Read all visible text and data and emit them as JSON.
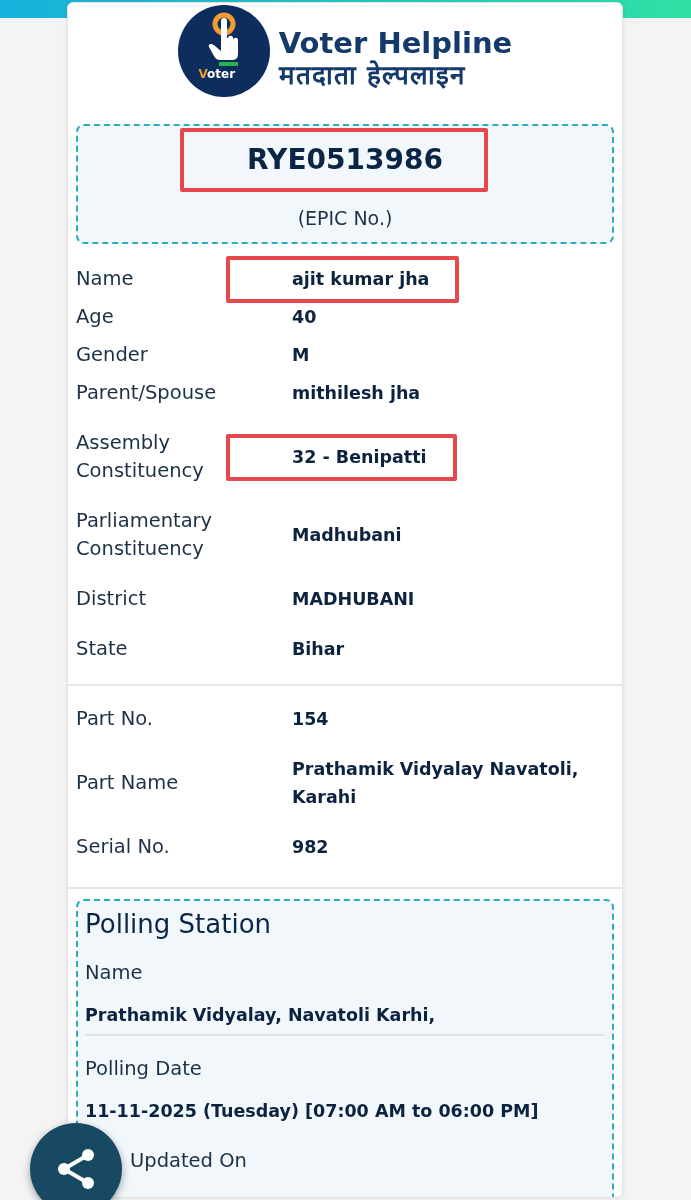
{
  "header": {
    "logo_caption": "Voter",
    "title": "Voter Helpline",
    "subtitle": "मतदाता हेल्पलाइन"
  },
  "epic": {
    "number": "RYE0513986",
    "caption": "(EPIC No.)",
    "highlighted": true
  },
  "voter_details": [
    {
      "label": "Name",
      "value": "ajit kumar jha",
      "highlighted": true
    },
    {
      "label": "Age",
      "value": "40",
      "highlighted": false
    },
    {
      "label": "Gender",
      "value": "M",
      "highlighted": false
    },
    {
      "label": "Parent/Spouse",
      "value": "mithilesh jha",
      "highlighted": false
    }
  ],
  "constituency_details": [
    {
      "label": "Assembly Constituency",
      "value": "32 - Benipatti",
      "highlighted": true
    },
    {
      "label": "Parliamentary Constituency",
      "value": "Madhubani",
      "highlighted": false
    },
    {
      "label": "District",
      "value": "MADHUBANI",
      "highlighted": false
    },
    {
      "label": "State",
      "value": "Bihar",
      "highlighted": false
    }
  ],
  "part_details": [
    {
      "label": "Part No.",
      "value": "154",
      "highlighted": false
    },
    {
      "label": "Part Name",
      "value": "Prathamik Vidyalay Navatoli, Karahi",
      "highlighted": false
    },
    {
      "label": "Serial No.",
      "value": "982",
      "highlighted": false
    }
  ],
  "polling_station": {
    "title": "Polling Station",
    "fields": [
      {
        "label": "Name",
        "value": "Prathamik Vidyalay, Navatoli Karhi,"
      },
      {
        "label": "Polling Date",
        "value": "11-11-2025 (Tuesday) [07:00 AM to 06:00 PM]"
      },
      {
        "label": "Updated On"
      }
    ]
  }
}
